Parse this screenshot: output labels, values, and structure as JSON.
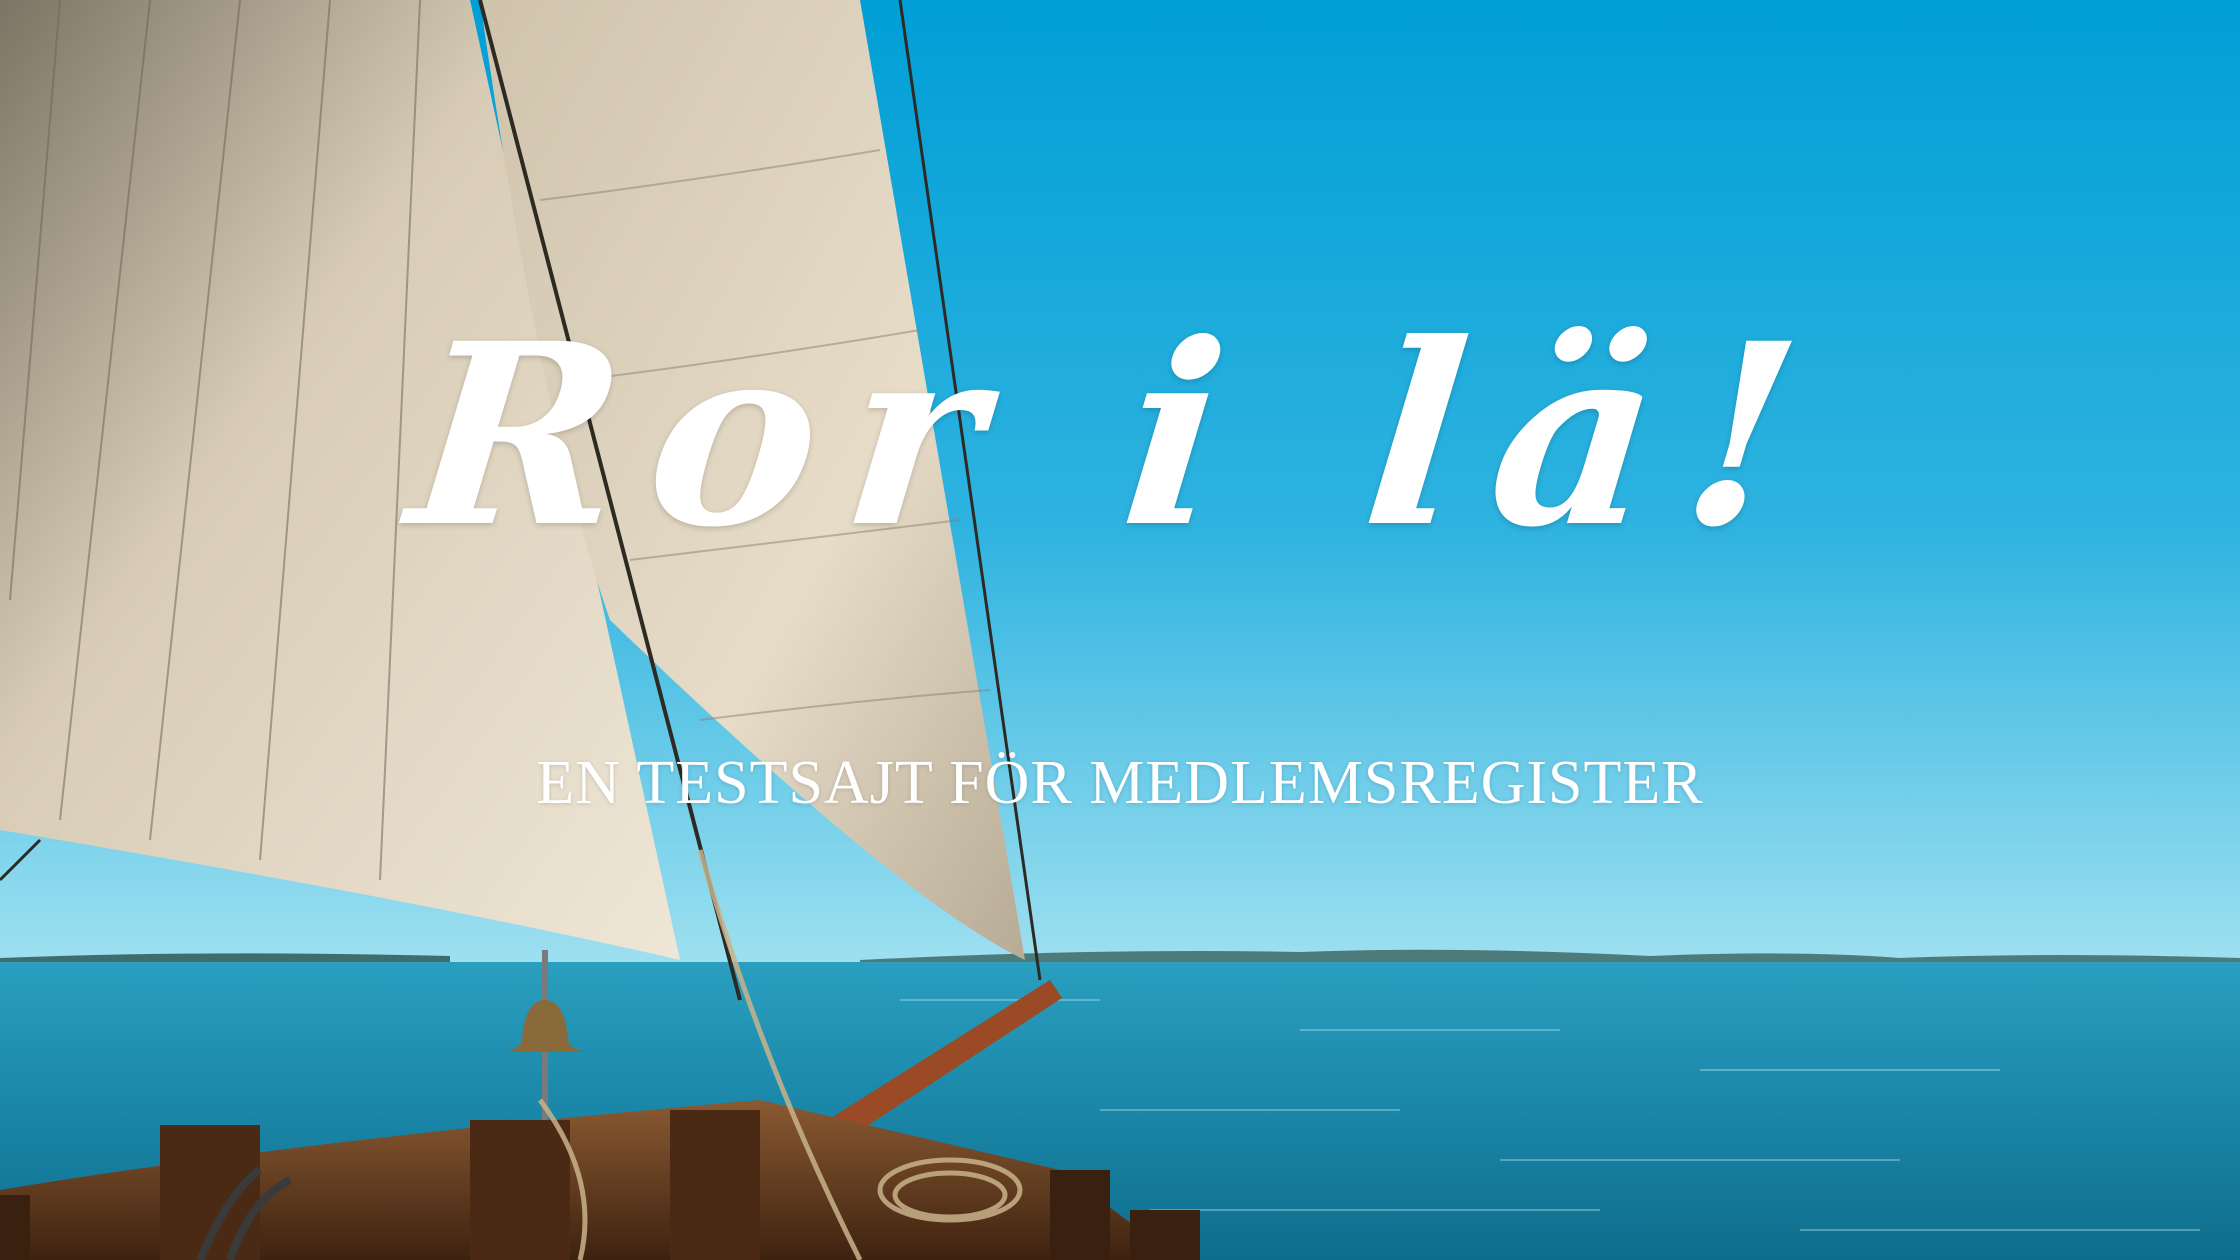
{
  "hero": {
    "title": "Ror i lä!",
    "subtitle": "EN TESTSAJT FÖR MEDLEMSREGISTER"
  },
  "colors": {
    "sky_top": "#0aa0d6",
    "sky_bottom": "#8fdcef",
    "sea": "#1a8fb0",
    "sail": "#e8e0d0",
    "wood": "#6b3a1f",
    "text": "#ffffff"
  }
}
